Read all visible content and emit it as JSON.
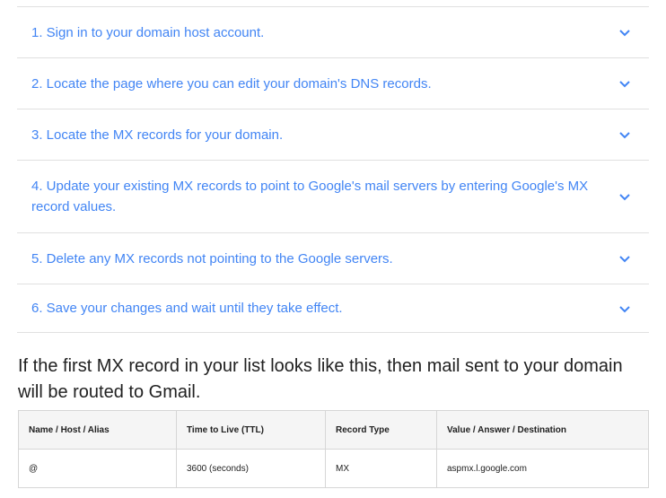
{
  "steps": [
    {
      "label": "1. Sign in to your domain host account."
    },
    {
      "label": "2. Locate the page where you can edit your domain's DNS records."
    },
    {
      "label": "3. Locate the MX records for your domain."
    },
    {
      "label": "4. Update your existing MX records to point to Google's mail servers by entering Google's MX record values."
    },
    {
      "label": "5. Delete any MX records not pointing to the Google servers."
    },
    {
      "label": "6. Save your changes and wait until they take effect."
    }
  ],
  "colors": {
    "link": "#4285f4",
    "divider": "#e0e0e0",
    "header_bg": "#f5f5f5"
  },
  "icons": {
    "expand": "chevron-down-icon"
  },
  "heading": "If the first MX record in your list looks like this, then mail sent to your domain will be routed to Gmail.",
  "table": {
    "headers": [
      "Name / Host / Alias",
      "Time to Live (TTL)",
      "Record Type",
      "Value / Answer / Destination"
    ],
    "rows": [
      [
        "@",
        "3600 (seconds)",
        "MX",
        "aspmx.l.google.com"
      ]
    ]
  }
}
